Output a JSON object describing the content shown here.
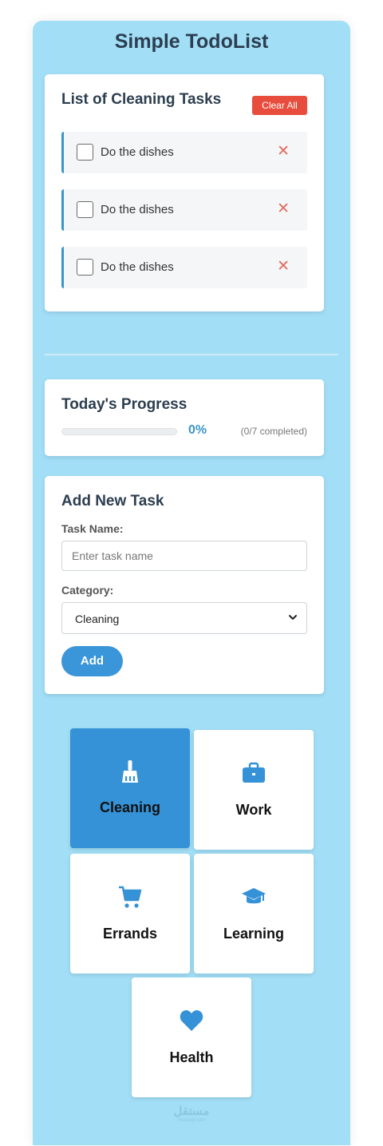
{
  "app": {
    "title": "Simple TodoList"
  },
  "task_list": {
    "heading": "List of Cleaning Tasks",
    "clear_label": "Clear All",
    "delete_symbol": "✕",
    "items": [
      {
        "text": "Do the dishes",
        "checked": false
      },
      {
        "text": "Do the dishes",
        "checked": false
      },
      {
        "text": "Do the dishes",
        "checked": false
      }
    ]
  },
  "progress": {
    "heading": "Today's Progress",
    "percent_label": "0%",
    "percent": 0,
    "count_label": "(0/7 completed)"
  },
  "add_task": {
    "heading": "Add New Task",
    "name_label": "Task Name:",
    "name_placeholder": "Enter task name",
    "name_value": "",
    "category_label": "Category:",
    "category_value": "Cleaning",
    "add_label": "Add"
  },
  "categories": [
    {
      "label": "Cleaning",
      "icon": "broom-icon",
      "active": true
    },
    {
      "label": "Work",
      "icon": "briefcase-icon",
      "active": false
    },
    {
      "label": "Errands",
      "icon": "cart-icon",
      "active": false
    },
    {
      "label": "Learning",
      "icon": "graduation-cap-icon",
      "active": false
    },
    {
      "label": "Health",
      "icon": "heart-icon",
      "active": false
    }
  ],
  "colors": {
    "background": "#a2dff7",
    "accent": "#3a96d8",
    "danger": "#e74c3c",
    "active_tile": "#3592d6"
  }
}
